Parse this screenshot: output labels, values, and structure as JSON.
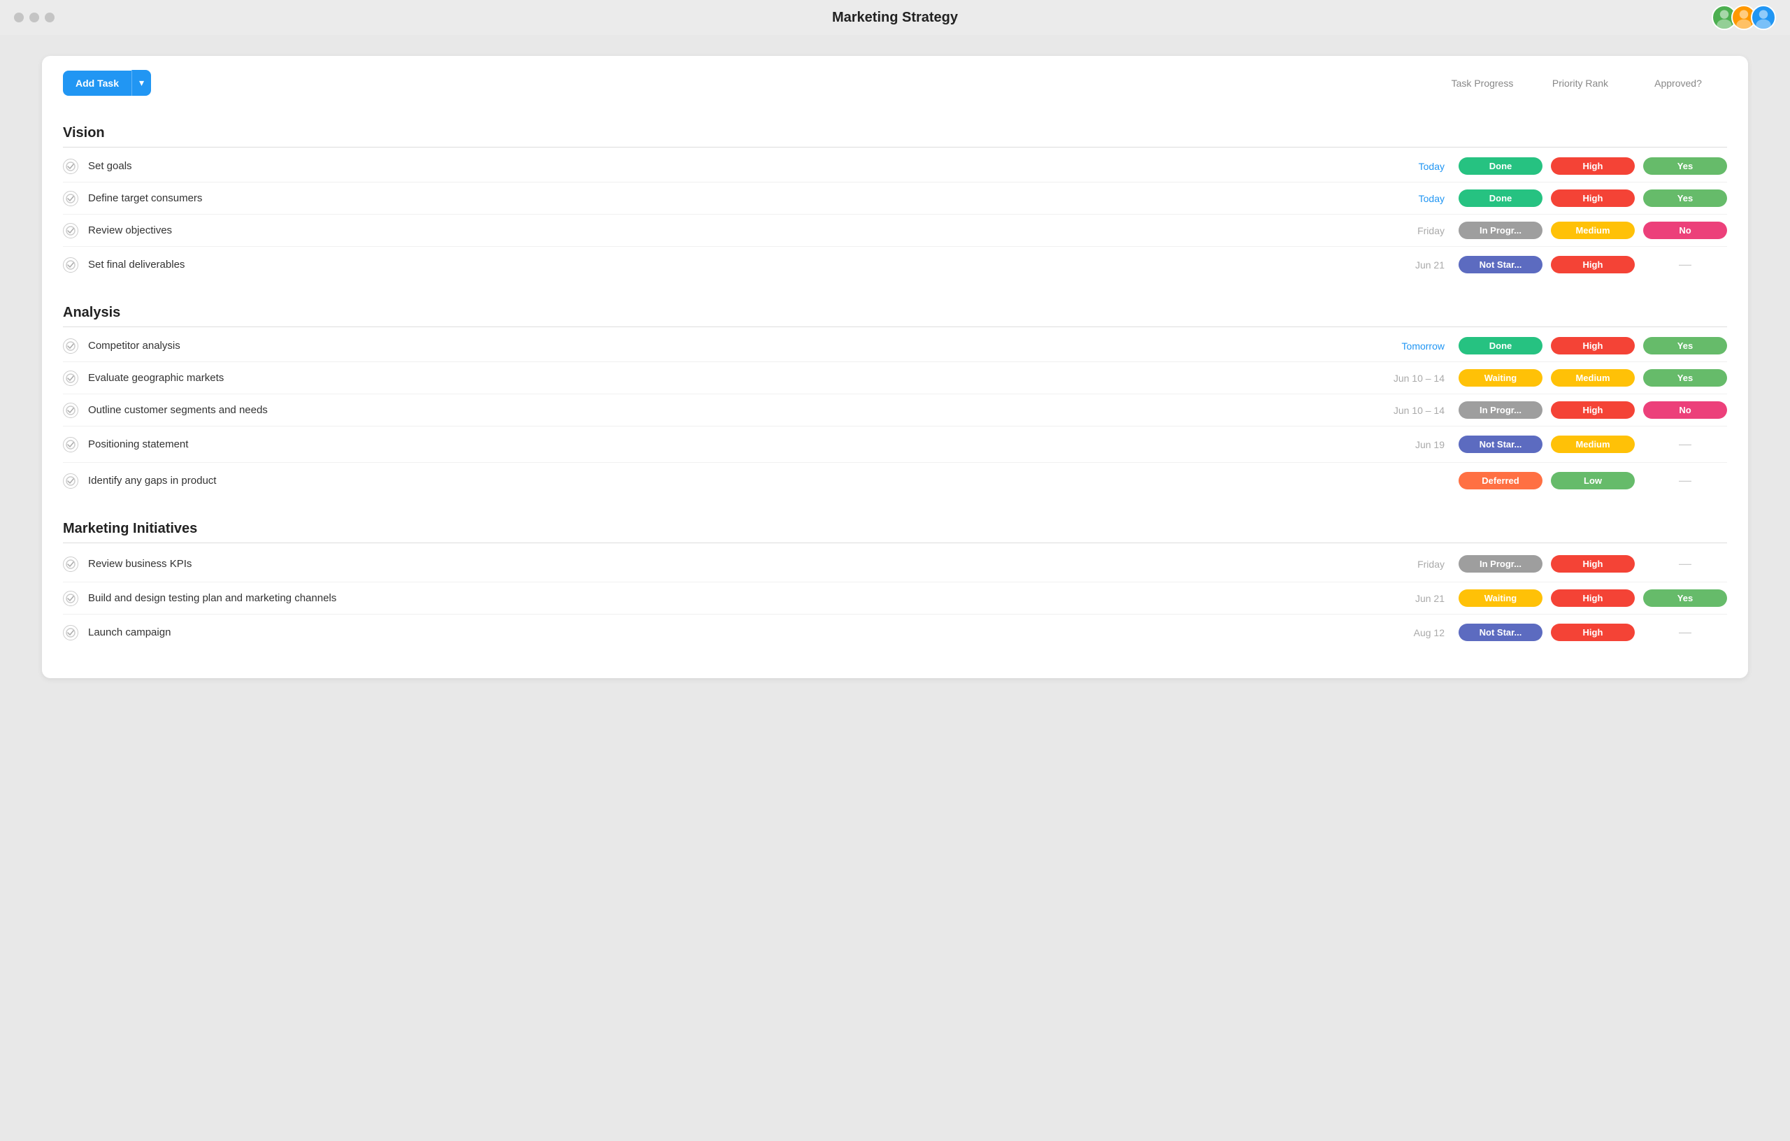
{
  "titleBar": {
    "title": "Marketing Strategy"
  },
  "avatars": [
    {
      "color": "#4CAF50",
      "label": "A1"
    },
    {
      "color": "#FF9800",
      "label": "A2"
    },
    {
      "color": "#2196F3",
      "label": "A3"
    }
  ],
  "toolbar": {
    "addTaskLabel": "Add Task",
    "dropdownIcon": "▾",
    "columns": [
      {
        "label": "Task Progress"
      },
      {
        "label": "Priority Rank"
      },
      {
        "label": "Approved?"
      }
    ]
  },
  "sections": [
    {
      "title": "Vision",
      "tasks": [
        {
          "name": "Set goals",
          "date": "Today",
          "dateType": "today",
          "progress": "Done",
          "progressType": "done",
          "priority": "High",
          "priorityType": "high",
          "approved": "Yes",
          "approvedType": "yes"
        },
        {
          "name": "Define target consumers",
          "date": "Today",
          "dateType": "today",
          "progress": "Done",
          "progressType": "done",
          "priority": "High",
          "priorityType": "high",
          "approved": "Yes",
          "approvedType": "yes"
        },
        {
          "name": "Review objectives",
          "date": "Friday",
          "dateType": "normal",
          "progress": "In Progr...",
          "progressType": "in-progress",
          "priority": "Medium",
          "priorityType": "medium",
          "approved": "No",
          "approvedType": "no"
        },
        {
          "name": "Set final deliverables",
          "date": "Jun 21",
          "dateType": "normal",
          "progress": "Not Star...",
          "progressType": "not-started",
          "priority": "High",
          "priorityType": "high",
          "approved": "—",
          "approvedType": "empty"
        }
      ]
    },
    {
      "title": "Analysis",
      "tasks": [
        {
          "name": "Competitor analysis",
          "date": "Tomorrow",
          "dateType": "tomorrow",
          "progress": "Done",
          "progressType": "done",
          "priority": "High",
          "priorityType": "high",
          "approved": "Yes",
          "approvedType": "yes"
        },
        {
          "name": "Evaluate geographic markets",
          "date": "Jun 10 – 14",
          "dateType": "normal",
          "progress": "Waiting",
          "progressType": "waiting",
          "priority": "Medium",
          "priorityType": "medium",
          "approved": "Yes",
          "approvedType": "yes"
        },
        {
          "name": "Outline customer segments and needs",
          "date": "Jun 10 – 14",
          "dateType": "normal",
          "progress": "In Progr...",
          "progressType": "in-progress",
          "priority": "High",
          "priorityType": "high",
          "approved": "No",
          "approvedType": "no"
        },
        {
          "name": "Positioning statement",
          "date": "Jun 19",
          "dateType": "normal",
          "progress": "Not Star...",
          "progressType": "not-started",
          "priority": "Medium",
          "priorityType": "medium",
          "approved": "—",
          "approvedType": "empty"
        },
        {
          "name": "Identify any gaps in product",
          "date": "",
          "dateType": "normal",
          "progress": "Deferred",
          "progressType": "deferred",
          "priority": "Low",
          "priorityType": "low",
          "approved": "—",
          "approvedType": "empty"
        }
      ]
    },
    {
      "title": "Marketing Initiatives",
      "tasks": [
        {
          "name": "Review business KPIs",
          "date": "Friday",
          "dateType": "normal",
          "progress": "In Progr...",
          "progressType": "in-progress",
          "priority": "High",
          "priorityType": "high",
          "approved": "—",
          "approvedType": "empty"
        },
        {
          "name": "Build and design testing plan and marketing channels",
          "date": "Jun 21",
          "dateType": "normal",
          "progress": "Waiting",
          "progressType": "waiting",
          "priority": "High",
          "priorityType": "high",
          "approved": "Yes",
          "approvedType": "yes"
        },
        {
          "name": "Launch campaign",
          "date": "Aug 12",
          "dateType": "normal",
          "progress": "Not Star...",
          "progressType": "not-started",
          "priority": "High",
          "priorityType": "high",
          "approved": "—",
          "approvedType": "empty"
        }
      ]
    }
  ]
}
